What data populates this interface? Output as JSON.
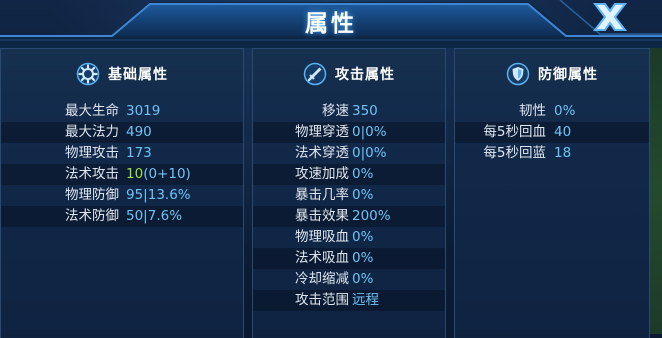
{
  "title": "属性",
  "close_icon": "close-x-icon",
  "panels": {
    "basic": {
      "label": "基础属性",
      "icon": "gear-icon",
      "rows": [
        {
          "key": "最大生命",
          "value": "3019"
        },
        {
          "key": "最大法力",
          "value": "490"
        },
        {
          "key": "物理攻击",
          "value": "173"
        },
        {
          "key": "法术攻击",
          "value_main": "10",
          "value_bonus": "(0+10)"
        },
        {
          "key": "物理防御",
          "value": "95|13.6%"
        },
        {
          "key": "法术防御",
          "value": "50|7.6%"
        }
      ]
    },
    "attack": {
      "label": "攻击属性",
      "icon": "sword-icon",
      "rows": [
        {
          "key": "移速",
          "value": "350"
        },
        {
          "key": "物理穿透",
          "value": "0|0%"
        },
        {
          "key": "法术穿透",
          "value": "0|0%"
        },
        {
          "key": "攻速加成",
          "value": "0%"
        },
        {
          "key": "暴击几率",
          "value": "0%"
        },
        {
          "key": "暴击效果",
          "value": "200%"
        },
        {
          "key": "物理吸血",
          "value": "0%"
        },
        {
          "key": "法术吸血",
          "value": "0%"
        },
        {
          "key": "冷却缩减",
          "value": "0%"
        },
        {
          "key": "攻击范围",
          "value": "远程"
        }
      ]
    },
    "defense": {
      "label": "防御属性",
      "icon": "shield-icon",
      "rows": [
        {
          "key": "韧性",
          "value": "0%"
        },
        {
          "key": "每5秒回血",
          "value": "40"
        },
        {
          "key": "每5秒回蓝",
          "value": "18"
        }
      ]
    }
  },
  "colors": {
    "value": "#6fc3f5",
    "bonus": "#9be14a",
    "title_glow": "#49a6ff"
  }
}
